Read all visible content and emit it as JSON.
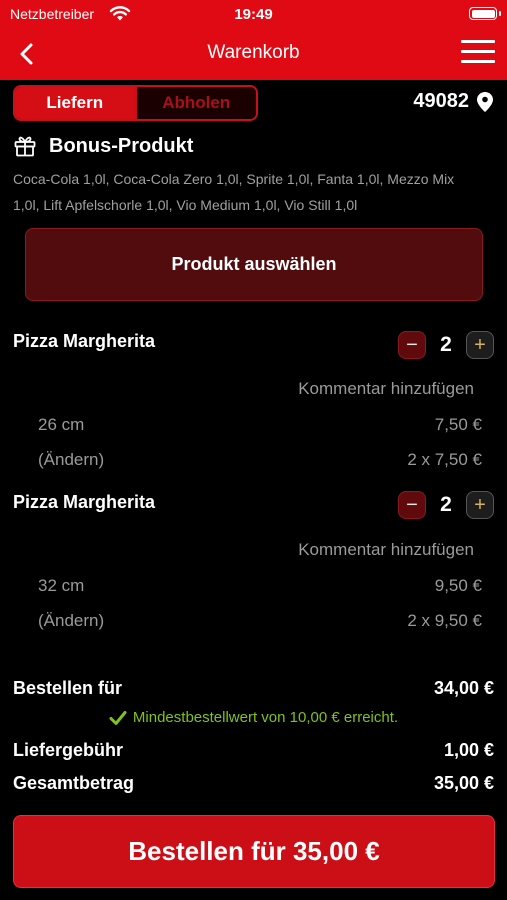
{
  "status": {
    "carrier": "Netzbetreiber",
    "time": "19:49"
  },
  "nav": {
    "title": "Warenkorb"
  },
  "delivery": {
    "options": [
      "Liefern",
      "Abholen"
    ],
    "zip": "49082"
  },
  "bonus": {
    "title": "Bonus-Produkt",
    "line1": "Coca-Cola 1,0l, Coca-Cola Zero 1,0l, Sprite 1,0l, Fanta 1,0l, Mezzo Mix",
    "line2": "1,0l, Lift Apfelschorle 1,0l, Vio Medium 1,0l, Vio Still 1,0l",
    "select_label": "Produkt auswählen"
  },
  "items": [
    {
      "name": "Pizza Margherita",
      "qty": "2",
      "comment": "Kommentar hinzufügen",
      "size": "26 cm",
      "unit_price": "7,50 €",
      "change": "(Ändern)",
      "total": "2 x 7,50 €"
    },
    {
      "name": "Pizza Margherita",
      "qty": "2",
      "comment": "Kommentar hinzufügen",
      "size": "32 cm",
      "unit_price": "9,50 €",
      "change": "(Ändern)",
      "total": "2 x 9,50 €"
    }
  ],
  "stepper": {
    "minus": "−",
    "plus": "+"
  },
  "summary": {
    "order_for_label": "Bestellen für",
    "order_for_value": "34,00 €",
    "min_note": "Mindestbestellwert von 10,00 € erreicht.",
    "delivery_fee_label": "Liefergebühr",
    "delivery_fee_value": "1,00 €",
    "total_label": "Gesamtbetrag",
    "total_value": "35,00 €"
  },
  "order_button": "Bestellen für 35,00 €",
  "colors": {
    "brand_red": "#e00a14",
    "success_green": "#7fc21c",
    "stepper_plus": "#d8b25a"
  }
}
